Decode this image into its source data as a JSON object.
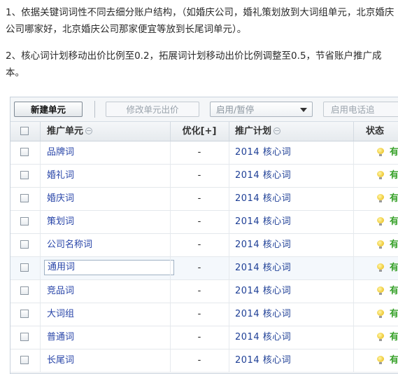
{
  "notes": [
    "1、依据关键词词性不同去细分账户结构，（如婚庆公司，婚礼策划放到大词组单元，北京婚庆公司哪家好，北京婚庆公司那家便宜等放到长尾词单元）。",
    "2、核心词计划移动出价比例至0.2，拓展词计划移动出价比例调整至0.5，节省账户推广成本。"
  ],
  "toolbar": {
    "new_unit": "新建单元",
    "edit_bid": "修改单元出价",
    "enable_pause": "启用/暂停",
    "enable_phone": "启用电话追"
  },
  "table": {
    "headers": {
      "unit": "推广单元",
      "optimize": "优化[+]",
      "plan": "推广计划",
      "status": "状态"
    },
    "rows": [
      {
        "unit": "品牌词",
        "optimize": "-",
        "plan": "2014 核心词",
        "status": "有"
      },
      {
        "unit": "婚礼词",
        "optimize": "-",
        "plan": "2014 核心词",
        "status": "有"
      },
      {
        "unit": "婚庆词",
        "optimize": "-",
        "plan": "2014 核心词",
        "status": "有"
      },
      {
        "unit": "策划词",
        "optimize": "-",
        "plan": "2014 核心词",
        "status": "有"
      },
      {
        "unit": "公司名称词",
        "optimize": "-",
        "plan": "2014 核心词",
        "status": "有"
      },
      {
        "unit": "通用词",
        "optimize": "-",
        "plan": "2014 核心词",
        "status": "有"
      },
      {
        "unit": "竞品词",
        "optimize": "-",
        "plan": "2014 核心词",
        "status": "有"
      },
      {
        "unit": "大词组",
        "optimize": "-",
        "plan": "2014 核心词",
        "status": "有"
      },
      {
        "unit": "普通词",
        "optimize": "-",
        "plan": "2014 核心词",
        "status": "有"
      },
      {
        "unit": "长尾词",
        "optimize": "-",
        "plan": "2014 核心词",
        "status": "有"
      }
    ]
  },
  "icons": {
    "status": "lightbulb-icon",
    "sort": "sort-icon"
  },
  "colors": {
    "link": "#2845a8",
    "plan": "#1e3f96",
    "status_active": "#38a12a",
    "bulb": "#e7b400"
  }
}
